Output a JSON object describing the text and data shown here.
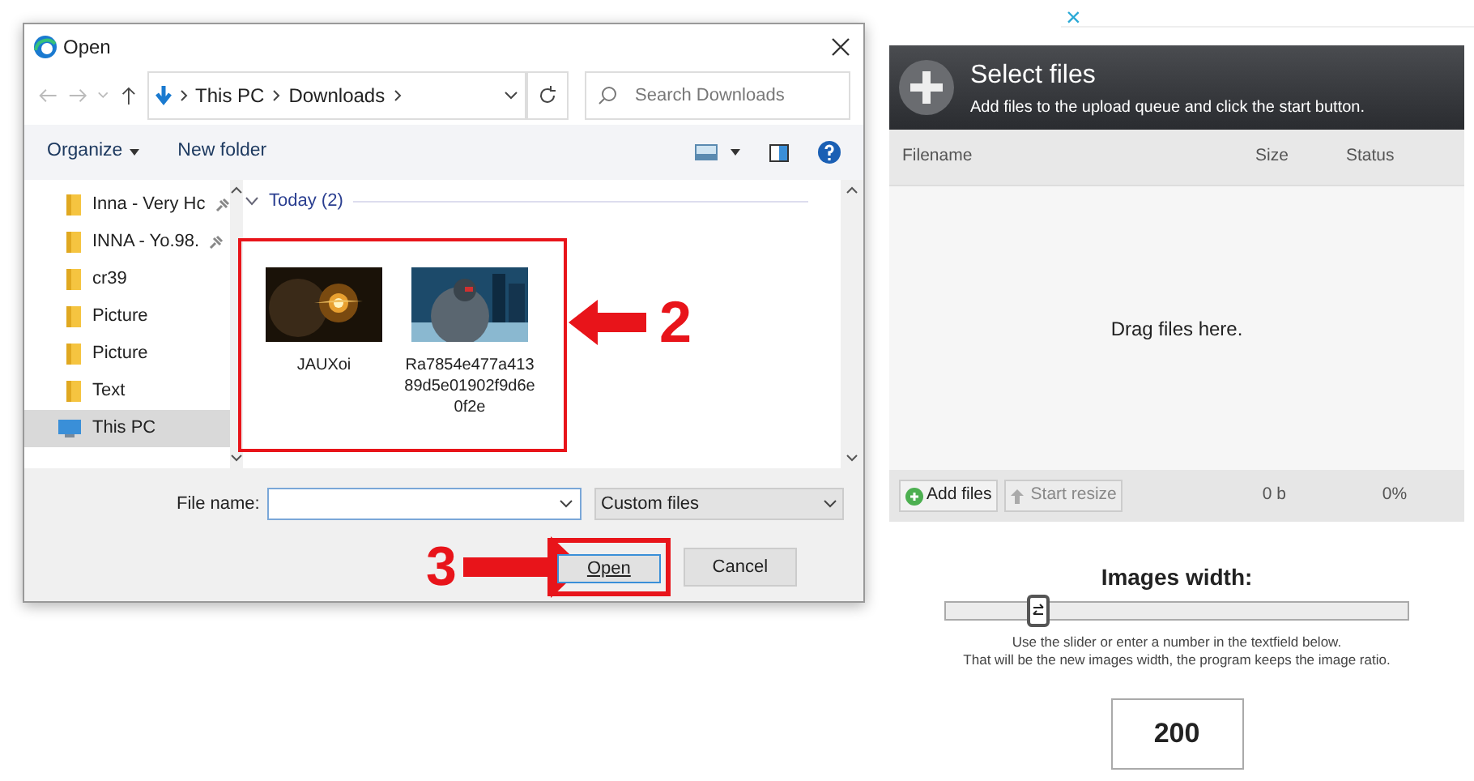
{
  "dialog": {
    "title": "Open",
    "breadcrumb": [
      "This PC",
      "Downloads"
    ],
    "search": {
      "placeholder": "Search Downloads"
    },
    "toolbar": [
      "Organize",
      "New folder"
    ],
    "sidebar": {
      "items": [
        {
          "label": "Inna - Very Hc",
          "pinned": true,
          "kind": "folder",
          "selected": false
        },
        {
          "label": "INNA - Yo.98.",
          "pinned": true,
          "kind": "folder",
          "selected": false
        },
        {
          "label": "cr39",
          "pinned": false,
          "kind": "folder",
          "selected": false
        },
        {
          "label": "Picture",
          "pinned": false,
          "kind": "folder",
          "selected": false
        },
        {
          "label": "Picture",
          "pinned": false,
          "kind": "folder",
          "selected": false
        },
        {
          "label": "Text",
          "pinned": false,
          "kind": "folder",
          "selected": false
        },
        {
          "label": "This PC",
          "pinned": false,
          "kind": "computer",
          "selected": true
        }
      ]
    },
    "group": {
      "label": "Today (2)",
      "expanded": true
    },
    "files": [
      {
        "name": "JAUXoi",
        "kind": "fire"
      },
      {
        "name": "Ra7854e477a41389d5e01902f9d6e0f2e",
        "kind": "city"
      }
    ],
    "file_name": {
      "label": "File name:"
    },
    "file_type": "Custom files",
    "buttons": [
      "Open",
      "Cancel"
    ]
  },
  "annotations": [
    {
      "label": "2"
    },
    {
      "label": "3"
    }
  ],
  "uploader": {
    "title": "Select files",
    "subtitle": "Add files to the upload queue and click the start button.",
    "columns": [
      "Filename",
      "Size",
      "Status"
    ],
    "drop_hint": "Drag files here.",
    "add_button": "Add files",
    "start_button": {
      "label": "Start resize",
      "disabled": true
    },
    "total_size": "0 b",
    "total_percent": "0%"
  },
  "width_setting": {
    "title": "Images width:",
    "level": 0.2,
    "help": [
      "Use the slider or enter a number in the textfield below.",
      "That will be the new images width, the program keeps the image ratio."
    ],
    "value": "200"
  },
  "ad_close": "×"
}
